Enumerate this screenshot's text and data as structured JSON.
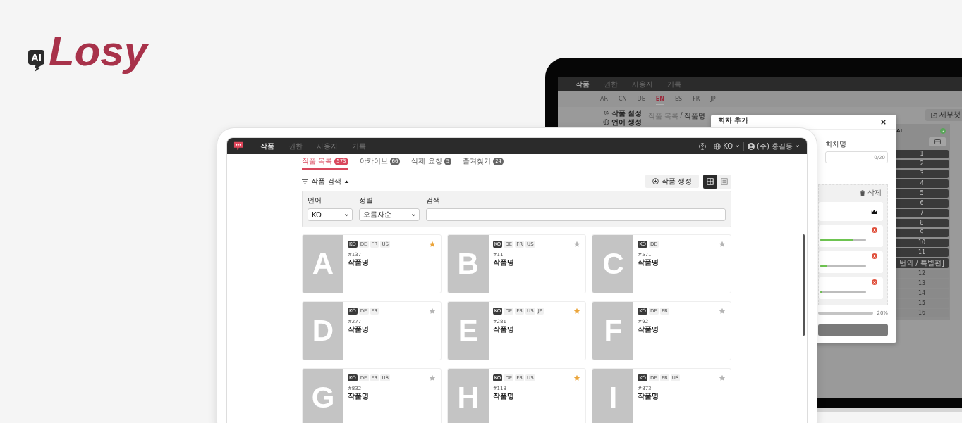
{
  "brand": {
    "badge": "AI",
    "name": "Losy"
  },
  "back_screen": {
    "nav": [
      {
        "label": "작품",
        "selected": true
      },
      {
        "label": "권한",
        "selected": false
      },
      {
        "label": "사용자",
        "selected": false
      },
      {
        "label": "기록",
        "selected": false
      }
    ],
    "languages": [
      {
        "label": "AR",
        "selected": false
      },
      {
        "label": "CN",
        "selected": false
      },
      {
        "label": "DE",
        "selected": false
      },
      {
        "label": "EN",
        "selected": true
      },
      {
        "label": "ES",
        "selected": false
      },
      {
        "label": "FR",
        "selected": false
      },
      {
        "label": "JP",
        "selected": false
      }
    ],
    "sidebar": [
      {
        "label": "작품 설정",
        "kind": "settings"
      },
      {
        "label": "언어 생성",
        "kind": "language"
      }
    ],
    "breadcrumb": {
      "parent": "작품 목록",
      "separator": "/",
      "current": "작품명"
    },
    "side_button": "세부챗",
    "episodes": {
      "header": "AL",
      "items": [
        {
          "label": "1",
          "kind": "done"
        },
        {
          "label": "2",
          "kind": "done"
        },
        {
          "label": "3",
          "kind": "done"
        },
        {
          "label": "4",
          "kind": "done"
        },
        {
          "label": "5",
          "kind": "done"
        },
        {
          "label": "6",
          "kind": "done"
        },
        {
          "label": "7",
          "kind": "done"
        },
        {
          "label": "8",
          "kind": "done"
        },
        {
          "label": "9",
          "kind": "done"
        },
        {
          "label": "10",
          "kind": "done"
        },
        {
          "label": "11",
          "kind": "done"
        },
        {
          "label": "번외 / 특별편]",
          "kind": "done"
        },
        {
          "label": "12",
          "kind": "pending"
        },
        {
          "label": "13",
          "kind": "pending"
        },
        {
          "label": "14",
          "kind": "pending"
        },
        {
          "label": "15",
          "kind": "pending"
        },
        {
          "label": "16",
          "kind": "pending"
        }
      ]
    },
    "modal": {
      "title": "회차 추가",
      "field_label": "회차명",
      "counter": "0/20",
      "delete": "삭제",
      "total": "20%",
      "rows": [
        {
          "kind": "header"
        },
        {
          "kind": "progress",
          "level": 0.73
        },
        {
          "kind": "progress",
          "level": 0.15
        },
        {
          "kind": "progress",
          "level": 0
        }
      ]
    }
  },
  "front_screen": {
    "nav": [
      {
        "label": "작품",
        "selected": true
      },
      {
        "label": "권한",
        "selected": false
      },
      {
        "label": "사용자",
        "selected": false
      },
      {
        "label": "기록",
        "selected": false
      }
    ],
    "language": "KO",
    "user": "(주) 홍길동",
    "tabs": [
      {
        "label": "작품 목록",
        "count": "573",
        "selected": true
      },
      {
        "label": "아카이브",
        "count": "66",
        "selected": false
      },
      {
        "label": "삭제 요청",
        "count": "5",
        "selected": false
      },
      {
        "label": "즐겨찾기",
        "count": "24",
        "selected": false
      }
    ],
    "search_toggle": "작품 검색",
    "create_button": "작품 생성",
    "views": [
      {
        "kind": "grid",
        "selected": true
      },
      {
        "kind": "list",
        "selected": false
      }
    ],
    "filters": {
      "language": {
        "label": "언어",
        "value": "KO"
      },
      "sort": {
        "label": "정렬",
        "value": "오름차순"
      },
      "search": {
        "label": "검색"
      }
    },
    "works": [
      {
        "cover": "A",
        "languages": [
          {
            "code": "KO",
            "selected": true
          },
          {
            "code": "DE",
            "selected": false
          },
          {
            "code": "FR",
            "selected": false
          },
          {
            "code": "US",
            "selected": false
          }
        ],
        "id": "#137",
        "title": "작품명",
        "favorite": true
      },
      {
        "cover": "B",
        "languages": [
          {
            "code": "KO",
            "selected": true
          },
          {
            "code": "DE",
            "selected": false
          },
          {
            "code": "FR",
            "selected": false
          },
          {
            "code": "US",
            "selected": false
          }
        ],
        "id": "#11",
        "title": "작품명",
        "favorite": false
      },
      {
        "cover": "C",
        "languages": [
          {
            "code": "KO",
            "selected": true
          },
          {
            "code": "DE",
            "selected": false
          }
        ],
        "id": "#571",
        "title": "작품명",
        "favorite": false
      },
      {
        "cover": "D",
        "languages": [
          {
            "code": "KO",
            "selected": true
          },
          {
            "code": "DE",
            "selected": false
          },
          {
            "code": "FR",
            "selected": false
          }
        ],
        "id": "#277",
        "title": "작품명",
        "favorite": false
      },
      {
        "cover": "E",
        "languages": [
          {
            "code": "KO",
            "selected": true
          },
          {
            "code": "DE",
            "selected": false
          },
          {
            "code": "FR",
            "selected": false
          },
          {
            "code": "US",
            "selected": false
          },
          {
            "code": "JP",
            "selected": false
          }
        ],
        "id": "#281",
        "title": "작품명",
        "favorite": true
      },
      {
        "cover": "F",
        "languages": [
          {
            "code": "KO",
            "selected": true
          },
          {
            "code": "DE",
            "selected": false
          },
          {
            "code": "FR",
            "selected": false
          }
        ],
        "id": "#92",
        "title": "작품명",
        "favorite": false
      },
      {
        "cover": "G",
        "languages": [
          {
            "code": "KO",
            "selected": true
          },
          {
            "code": "DE",
            "selected": false
          },
          {
            "code": "FR",
            "selected": false
          },
          {
            "code": "US",
            "selected": false
          }
        ],
        "id": "#832",
        "title": "작품명",
        "favorite": false
      },
      {
        "cover": "H",
        "languages": [
          {
            "code": "KO",
            "selected": true
          },
          {
            "code": "DE",
            "selected": false
          },
          {
            "code": "FR",
            "selected": false
          },
          {
            "code": "US",
            "selected": false
          }
        ],
        "id": "#118",
        "title": "작품명",
        "favorite": true
      },
      {
        "cover": "I",
        "languages": [
          {
            "code": "KO",
            "selected": true
          },
          {
            "code": "DE",
            "selected": false
          },
          {
            "code": "FR",
            "selected": false
          },
          {
            "code": "US",
            "selected": false
          }
        ],
        "id": "#873",
        "title": "작품명",
        "favorite": false
      }
    ]
  }
}
